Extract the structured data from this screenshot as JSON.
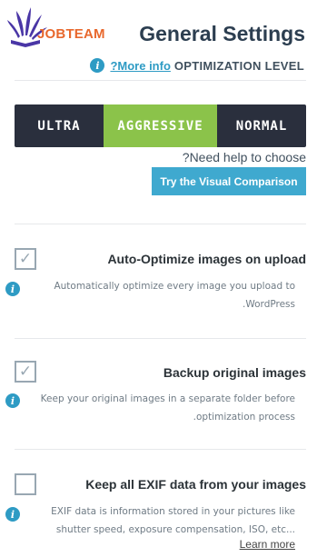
{
  "brand": {
    "name": "JOBTEAM",
    "primary_color": "#e8682d",
    "logo_icon": "book-leaves-logo"
  },
  "header": {
    "title": "General Settings"
  },
  "optimization": {
    "more_info": "?More info",
    "level_label": "OPTIMIZATION LEVEL",
    "levels": [
      "ULTRA",
      "AGGRESSIVE",
      "NORMAL"
    ],
    "selected": "AGGRESSIVE",
    "need_help": "?Need help to choose",
    "visual_button": "Try the Visual Comparison"
  },
  "options": [
    {
      "title": "Auto-Optimize images on upload",
      "checked": true,
      "desc_line1": "Automatically optimize every image you upload to",
      "desc_line2": ".WordPress"
    },
    {
      "title": "Backup original images",
      "checked": true,
      "desc_line1": "Keep your original images in a separate folder before",
      "desc_line2": ".optimization process"
    },
    {
      "title": "Keep all EXIF data from your images",
      "checked": false,
      "desc_line1": "EXIF data is information stored in your pictures like",
      "desc_line2": "shutter speed, exposure compensation, ISO, etc...",
      "learn_more": "Learn more"
    }
  ],
  "icons": {
    "info": "i",
    "check": "✓"
  },
  "colors": {
    "segment_bg": "#2a2f3d",
    "segment_active": "#8bc34a",
    "accent_blue": "#3fa9cf"
  }
}
